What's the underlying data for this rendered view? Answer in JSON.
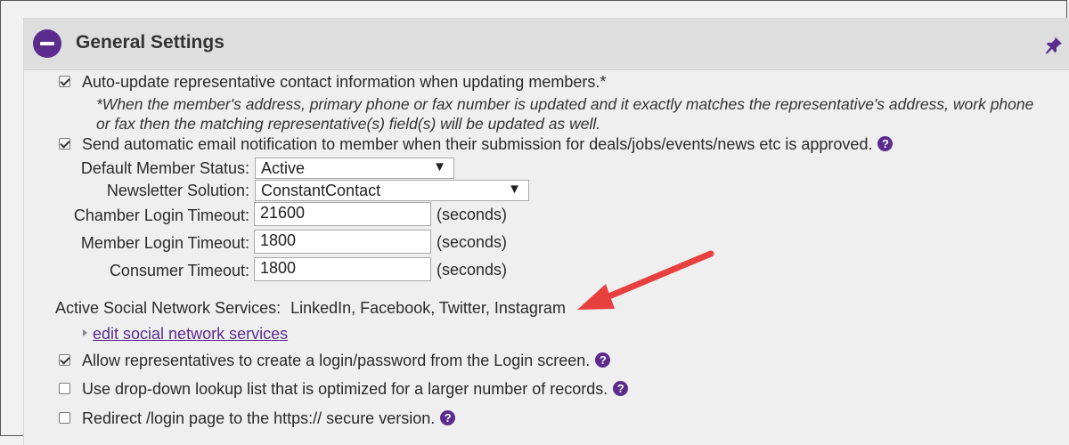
{
  "header": {
    "title": "General Settings"
  },
  "options": {
    "auto_update": {
      "label": "Auto-update representative contact information when updating members.*",
      "checked": true
    },
    "auto_update_note": {
      "line1": "*When the member's address, primary phone or fax number is updated and it exactly matches the representative's address, work phone",
      "line2": "or fax then the matching representative(s) field(s) will be updated as well."
    },
    "email_notify": {
      "label": "Send automatic email notification to member when their submission for deals/jobs/events/news etc is approved.",
      "checked": true
    },
    "allow_login": {
      "label": "Allow representatives to create a login/password from the Login screen.",
      "checked": true
    },
    "dropdown_lookup": {
      "label": "Use drop-down lookup list that is optimized for a larger number of records.",
      "checked": false
    },
    "redirect_https": {
      "label": "Redirect /login page to the https:// secure version.",
      "checked": false
    }
  },
  "fields": {
    "default_status": {
      "label": "Default Member Status:",
      "value": "Active"
    },
    "newsletter": {
      "label": "Newsletter Solution:",
      "value": "ConstantContact"
    },
    "chamber_timeout": {
      "label": "Chamber Login Timeout:",
      "value": "21600",
      "unit": "(seconds)"
    },
    "member_timeout": {
      "label": "Member Login Timeout:",
      "value": "1800",
      "unit": "(seconds)"
    },
    "consumer_timeout": {
      "label": "Consumer Timeout:",
      "value": "1800",
      "unit": "(seconds)"
    }
  },
  "social": {
    "label": "Active Social Network Services:",
    "value": "LinkedIn, Facebook, Twitter, Instagram",
    "edit_link": "edit social network services"
  },
  "help_glyph": "?",
  "dropdown_glyph": "▼",
  "colors": {
    "accent": "#5b2c8e",
    "annotation_arrow": "#e8403e",
    "header_bg": "#dedede"
  },
  "icons": {
    "collapse": "minus-circle-icon",
    "pin": "pushpin-icon",
    "help": "question-circle-icon"
  }
}
